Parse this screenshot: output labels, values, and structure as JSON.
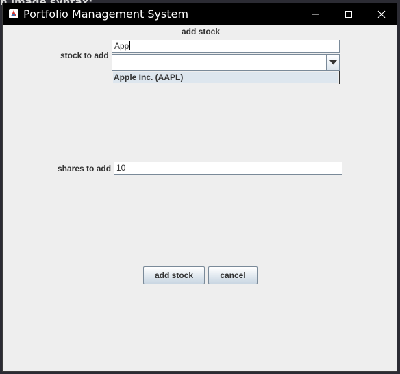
{
  "window": {
    "title": "Portfolio Management System"
  },
  "background": {
    "fragment": "n image syntax:"
  },
  "form": {
    "heading": "add stock",
    "stock_label": "stock to add",
    "stock_input_value": "App",
    "suggestions": [
      "Apple Inc. (AAPL)"
    ],
    "shares_label": "shares to add",
    "shares_input_value": "10"
  },
  "buttons": {
    "add_stock": "add stock",
    "cancel": "cancel"
  }
}
